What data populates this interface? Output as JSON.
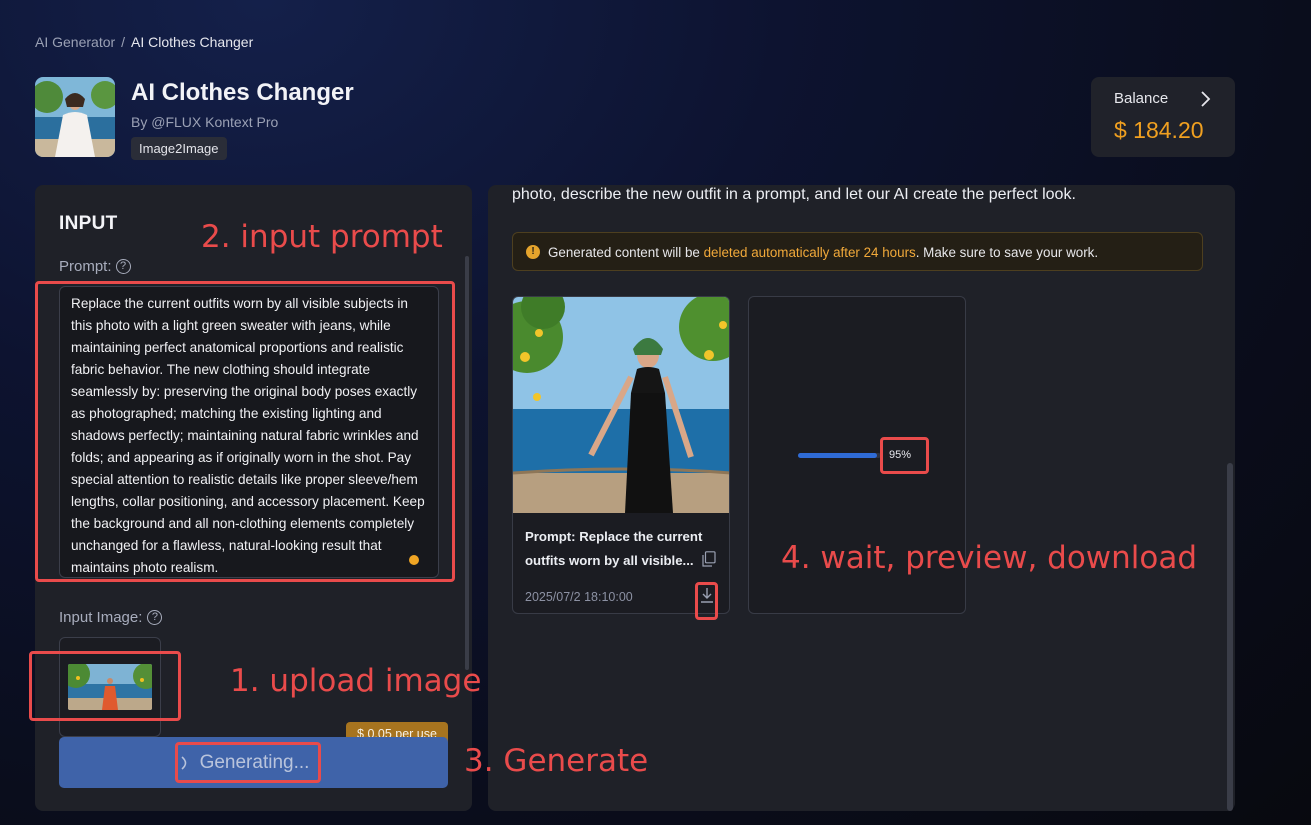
{
  "breadcrumb": {
    "parent": "AI Generator",
    "separator": "/",
    "current": "AI Clothes Changer"
  },
  "app": {
    "title": "AI Clothes Changer",
    "author": "By @FLUX Kontext Pro",
    "tag": "Image2Image",
    "thumb_icon": "woman-in-white-dress-image"
  },
  "balance": {
    "label": "Balance",
    "value": "$ 184.20",
    "arrow_icon": "chevron-right-icon"
  },
  "input": {
    "heading": "INPUT",
    "prompt_label": "Prompt:",
    "prompt_value": "Replace the current outfits worn by all visible subjects in this photo with a light green sweater with jeans, while maintaining perfect anatomical proportions and realistic fabric behavior. The new clothing should integrate seamlessly by: preserving the original body poses exactly as photographed; matching the existing lighting and shadows perfectly; maintaining natural fabric wrinkles and folds; and appearing as if originally worn in the shot. Pay special attention to realistic details like proper sleeve/hem lengths, collar positioning, and accessory placement. Keep the background and all non-clothing elements completely unchanged for a flawless, natural-looking result that maintains photo realism.",
    "image_label": "Input Image:",
    "help_icon": "?",
    "price_badge": "$ 0.05 per use",
    "generate_label": "Generating..."
  },
  "output": {
    "description": "photo, describe the new outfit in a prompt, and let our AI create the perfect look.",
    "notice_prefix": "Generated content will be ",
    "notice_highlight": "deleted automatically after 24 hours",
    "notice_suffix": ". Make sure to save your work.",
    "notice_icon": "!",
    "result": {
      "prompt": "Prompt: Replace the current outfits worn by all visible...",
      "date": "2025/07/2 18:10:00"
    },
    "pending": {
      "progress_text": "95%",
      "progress": 0.95
    }
  },
  "annotations": {
    "step1": "1. upload image",
    "step2": "2. input prompt",
    "step3": "3. Generate",
    "step4": "4. wait, preview, download"
  },
  "colors": {
    "accent": "#f0a020",
    "button": "#3f63a9",
    "annotation": "#e94b4b",
    "progress": "#2f6bd6"
  }
}
